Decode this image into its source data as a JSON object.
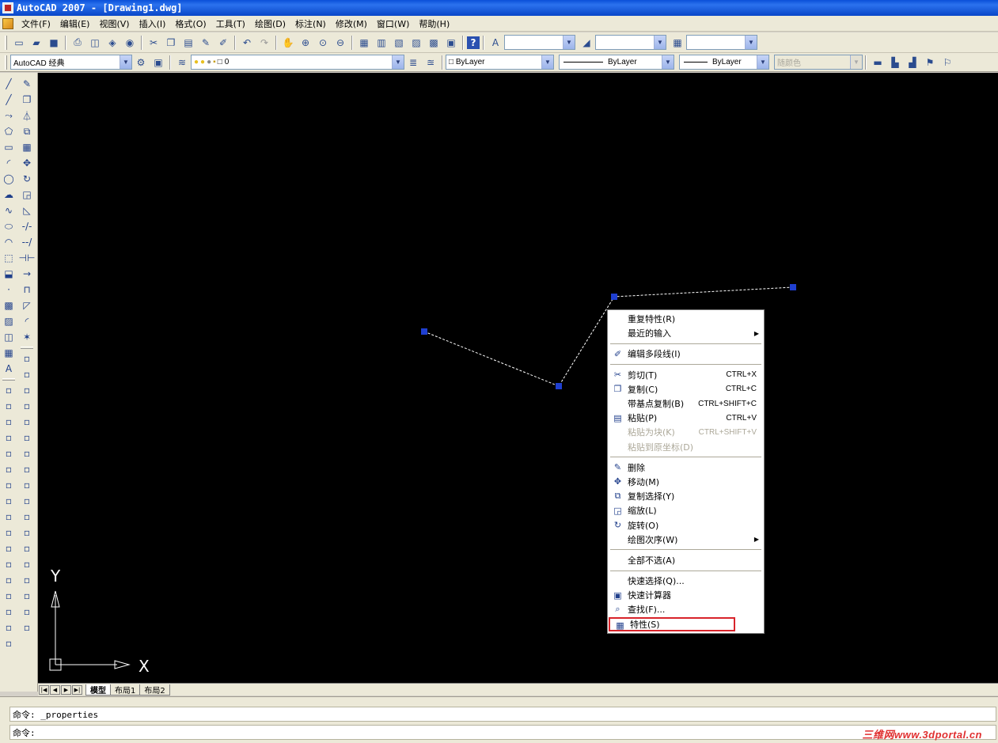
{
  "window": {
    "title": "AutoCAD 2007 - [Drawing1.dwg]"
  },
  "menubar": {
    "items": [
      "文件(F)",
      "编辑(E)",
      "视图(V)",
      "插入(I)",
      "格式(O)",
      "工具(T)",
      "绘图(D)",
      "标注(N)",
      "修改(M)",
      "窗口(W)",
      "帮助(H)"
    ]
  },
  "toolbar2": {
    "workspace": "AutoCAD 经典",
    "layer": "0",
    "color": "ByLayer",
    "linetype": "ByLayer",
    "lineweight": "ByLayer",
    "plotstyle": "随颜色"
  },
  "icons": {
    "new": "new-file-icon",
    "open": "open-folder-icon",
    "save": "save-icon",
    "print": "print-icon",
    "preview": "print-preview-icon",
    "publish": "publish-icon",
    "cut": "cut-icon",
    "copy": "copy-icon",
    "paste": "paste-icon",
    "matchprop": "match-properties-icon",
    "undo": "undo-icon",
    "redo": "redo-icon",
    "pan": "pan-icon",
    "zoom": "zoom-realtime-icon",
    "help": "help-icon",
    "calculator": "quickcalc-icon"
  },
  "left_toolbar": {
    "draw_icons": [
      "line-icon",
      "construction-line-icon",
      "polyline-icon",
      "polygon-icon",
      "rectangle-icon",
      "arc-icon",
      "circle-icon",
      "revision-cloud-icon",
      "spline-icon",
      "ellipse-icon",
      "ellipse-arc-icon",
      "insert-block-icon",
      "make-block-icon",
      "point-icon",
      "hatch-icon",
      "gradient-icon",
      "region-icon",
      "table-icon",
      "multiline-text-icon"
    ],
    "modify_icons": [
      "erase-icon",
      "copy-object-icon",
      "mirror-icon",
      "offset-icon",
      "array-icon",
      "move-icon",
      "rotate-icon",
      "scale-icon",
      "stretch-icon",
      "trim-icon",
      "extend-icon",
      "break-at-point-icon",
      "break-icon",
      "join-icon",
      "chamfer-icon",
      "fillet-icon",
      "explode-icon"
    ]
  },
  "canvas": {
    "ucs_x_label": "X",
    "ucs_y_label": "Y"
  },
  "layout_tabs": [
    "模型",
    "布局1",
    "布局2"
  ],
  "context_menu": {
    "items": [
      {
        "label": "重复特性(R)",
        "icon": "",
        "shortcut": "",
        "submenu": false,
        "disabled": false
      },
      {
        "label": "最近的输入",
        "icon": "",
        "shortcut": "",
        "submenu": true,
        "disabled": false
      },
      {
        "sep": true
      },
      {
        "label": "编辑多段线(I)",
        "icon": "edit-polyline-icon",
        "shortcut": "",
        "submenu": false,
        "disabled": false
      },
      {
        "sep": true
      },
      {
        "label": "剪切(T)",
        "icon": "cut-icon",
        "shortcut": "CTRL+X",
        "submenu": false,
        "disabled": false
      },
      {
        "label": "复制(C)",
        "icon": "copy-icon",
        "shortcut": "CTRL+C",
        "submenu": false,
        "disabled": false
      },
      {
        "label": "带基点复制(B)",
        "icon": "",
        "shortcut": "CTRL+SHIFT+C",
        "submenu": false,
        "disabled": false
      },
      {
        "label": "粘贴(P)",
        "icon": "paste-icon",
        "shortcut": "CTRL+V",
        "submenu": false,
        "disabled": false
      },
      {
        "label": "粘贴为块(K)",
        "icon": "",
        "shortcut": "CTRL+SHIFT+V",
        "submenu": false,
        "disabled": true
      },
      {
        "label": "粘贴到原坐标(D)",
        "icon": "",
        "shortcut": "",
        "submenu": false,
        "disabled": true
      },
      {
        "sep": true
      },
      {
        "label": "删除",
        "icon": "erase-icon",
        "shortcut": "",
        "submenu": false,
        "disabled": false
      },
      {
        "label": "移动(M)",
        "icon": "move-icon",
        "shortcut": "",
        "submenu": false,
        "disabled": false
      },
      {
        "label": "复制选择(Y)",
        "icon": "copy-selection-icon",
        "shortcut": "",
        "submenu": false,
        "disabled": false
      },
      {
        "label": "缩放(L)",
        "icon": "scale-icon",
        "shortcut": "",
        "submenu": false,
        "disabled": false
      },
      {
        "label": "旋转(O)",
        "icon": "rotate-icon",
        "shortcut": "",
        "submenu": false,
        "disabled": false
      },
      {
        "label": "绘图次序(W)",
        "icon": "",
        "shortcut": "",
        "submenu": true,
        "disabled": false
      },
      {
        "sep": true
      },
      {
        "label": "全部不选(A)",
        "icon": "",
        "shortcut": "",
        "submenu": false,
        "disabled": false
      },
      {
        "sep": true
      },
      {
        "label": "快速选择(Q)...",
        "icon": "",
        "shortcut": "",
        "submenu": false,
        "disabled": false
      },
      {
        "label": "快速计算器",
        "icon": "quickcalc-icon",
        "shortcut": "",
        "submenu": false,
        "disabled": false
      },
      {
        "label": "查找(F)...",
        "icon": "find-icon",
        "shortcut": "",
        "submenu": false,
        "disabled": false
      },
      {
        "label": "特性(S)",
        "icon": "properties-icon",
        "shortcut": "",
        "submenu": false,
        "disabled": false,
        "highlighted": true
      }
    ]
  },
  "command": {
    "history": "命令: _properties",
    "prompt": "命令:"
  },
  "watermark": "三维网www.3dportal.cn",
  "colors": {
    "canvas_bg": "#000000",
    "grip": "#1f3fd0",
    "highlight_box": "#d8232a",
    "title_bar": "#0a4fd8"
  }
}
